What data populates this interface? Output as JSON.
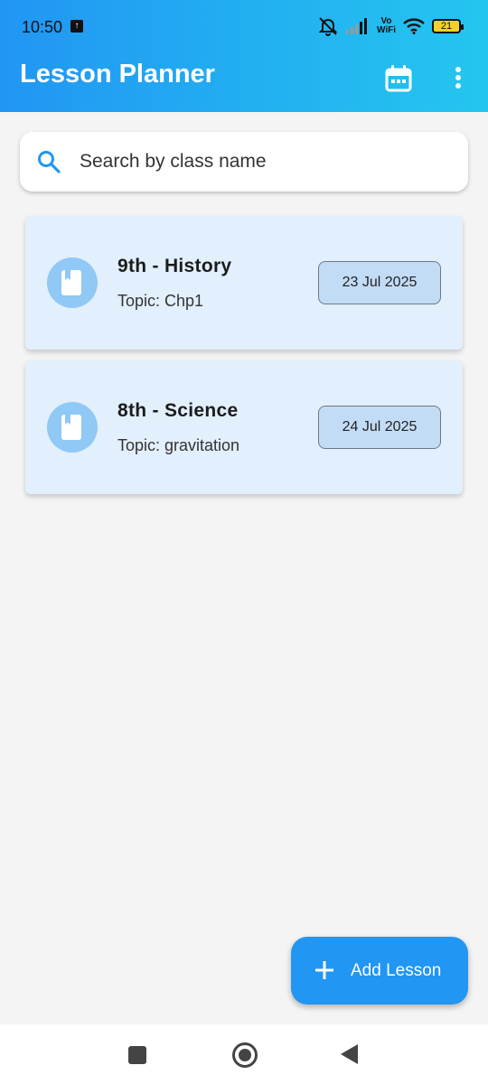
{
  "status_bar": {
    "time": "10:50",
    "upload_glyph": "↑",
    "vowifi_line1": "Vo",
    "vowifi_line2": "WiFi",
    "battery": "21",
    "icons": [
      "upload-notification-icon",
      "bell-off-icon",
      "signal-icon",
      "vowifi-icon",
      "wifi-icon",
      "battery-icon"
    ]
  },
  "app_bar": {
    "title": "Lesson Planner",
    "actions": [
      "calendar-icon",
      "more-vert-icon"
    ],
    "gradient": [
      "#2196f3",
      "#24c6ef"
    ]
  },
  "search": {
    "placeholder": "Search by class name",
    "value": "",
    "icon": "search-icon"
  },
  "lessons": [
    {
      "title": "9th - History",
      "topic": "Topic: Chp1",
      "date": "23 Jul 2025",
      "icon": "book-icon"
    },
    {
      "title": "8th - Science",
      "topic": "Topic: gravitation",
      "date": "24 Jul 2025",
      "icon": "book-icon"
    }
  ],
  "fab": {
    "label": "Add Lesson",
    "icon": "plus-icon"
  },
  "colors": {
    "primary": "#2196f3",
    "card_bg": "#e2effc",
    "chip_bg": "#c2dcf6",
    "avatar_bg": "#90c8f6",
    "page_bg": "#f4f4f4"
  },
  "nav_bar": {
    "buttons": [
      "recents-icon",
      "home-icon",
      "back-icon"
    ]
  }
}
